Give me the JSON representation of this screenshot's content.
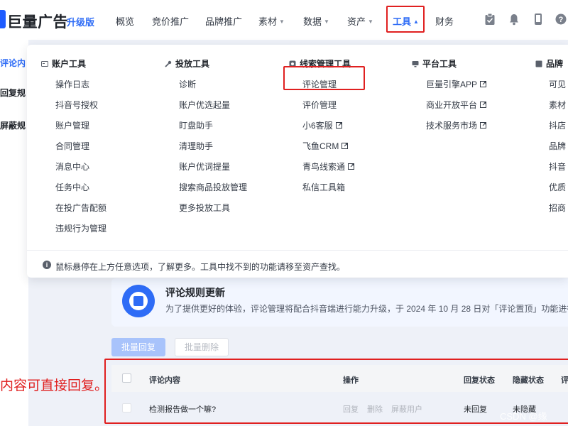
{
  "brand": {
    "name": "巨量广告",
    "badge": "升级版"
  },
  "nav": [
    {
      "label": "概览",
      "caret": false
    },
    {
      "label": "竞价推广",
      "caret": false
    },
    {
      "label": "品牌推广",
      "caret": false
    },
    {
      "label": "素材",
      "caret": true
    },
    {
      "label": "数据",
      "caret": true
    },
    {
      "label": "资产",
      "caret": true
    },
    {
      "label": "工具",
      "caret": true,
      "active": true
    },
    {
      "label": "财务",
      "caret": false
    }
  ],
  "top_icons": [
    "clipboard-check-icon",
    "bell-icon",
    "phone-icon",
    "help-icon"
  ],
  "sidebar": [
    "评论内",
    "回复规",
    "屏蔽规"
  ],
  "dropdown": {
    "columns": [
      {
        "title": "账户工具",
        "icon": "account-tools-icon",
        "items": [
          "操作日志",
          "抖音号授权",
          "账户管理",
          "合同管理",
          "消息中心",
          "任务中心",
          "在投广告配额",
          "违规行为管理"
        ]
      },
      {
        "title": "投放工具",
        "icon": "wrench-icon",
        "items": [
          "诊断",
          "账户优选起量",
          "盯盘助手",
          "清理助手",
          "账户优词提量",
          "搜索商品投放管理",
          "更多投放工具"
        ]
      },
      {
        "title": "线索管理工具",
        "icon": "clue-tools-icon",
        "items": [
          "评论管理",
          "评价管理",
          "小6客服",
          "飞鱼CRM",
          "青鸟线索通",
          "私信工具箱"
        ]
      },
      {
        "title": "平台工具",
        "icon": "monitor-icon",
        "items": [
          "巨量引擎APP",
          "商业开放平台",
          "技术服务市场"
        ]
      },
      {
        "title": "品牌",
        "icon": "brand-tools-icon",
        "items": [
          "可见",
          "素材",
          "抖店",
          "品牌",
          "抖音",
          "优质",
          "招商"
        ]
      }
    ],
    "tip": "鼠标悬停在上方任意选项，了解更多。工具中找不到的功能请移至资产查找。"
  },
  "banner": {
    "title": "评论规则更新",
    "desc": "为了提供更好的体验，评论管理将配合抖音端进行能力升级，于 2024 年 10 月 28 日对「评论置顶」功能进行"
  },
  "actions": {
    "batch_reply": "批量回复",
    "batch_delete": "批量删除"
  },
  "table": {
    "headers": [
      "评论内容",
      "操作",
      "回复状态",
      "隐藏状态",
      "评"
    ],
    "row": {
      "content": "检测报告做一个嘛?",
      "ops": [
        "回复",
        "删除",
        "屏蔽用户"
      ],
      "reply_status": "未回复",
      "hide_status": "未隐藏"
    }
  },
  "annotation": "内容可直接回复。",
  "watermark": "CSDN @缘",
  "colors": {
    "accent": "#2e6cf6",
    "highlight": "#e02020"
  }
}
